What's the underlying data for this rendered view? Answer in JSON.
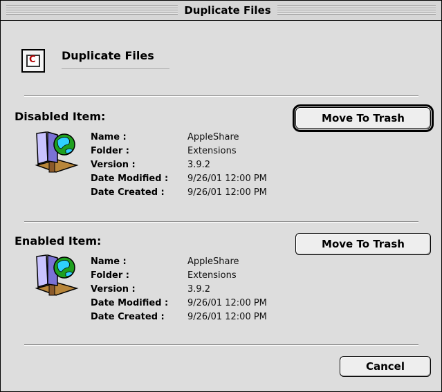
{
  "window": {
    "title": "Duplicate Files"
  },
  "header": {
    "title": "Duplicate Files",
    "icon": "extension-conflict-icon"
  },
  "disabled_section": {
    "title": "Disabled Item:",
    "button_label": "Move To Trash",
    "fields": [
      {
        "key": "Name :",
        "value": "AppleShare"
      },
      {
        "key": "Folder :",
        "value": "Extensions"
      },
      {
        "key": "Version :",
        "value": "3.9.2"
      },
      {
        "key": "Date Modified :",
        "value": "9/26/01 12:00 PM"
      },
      {
        "key": "Date Created :",
        "value": "9/26/01 12:00 PM"
      }
    ]
  },
  "enabled_section": {
    "title": "Enabled Item:",
    "button_label": "Move To Trash",
    "fields": [
      {
        "key": "Name :",
        "value": "AppleShare"
      },
      {
        "key": "Folder :",
        "value": "Extensions"
      },
      {
        "key": "Version :",
        "value": "3.9.2"
      },
      {
        "key": "Date Modified :",
        "value": "9/26/01 12:00 PM"
      },
      {
        "key": "Date Created :",
        "value": "9/26/01 12:00 PM"
      }
    ]
  },
  "footer": {
    "cancel_label": "Cancel"
  }
}
